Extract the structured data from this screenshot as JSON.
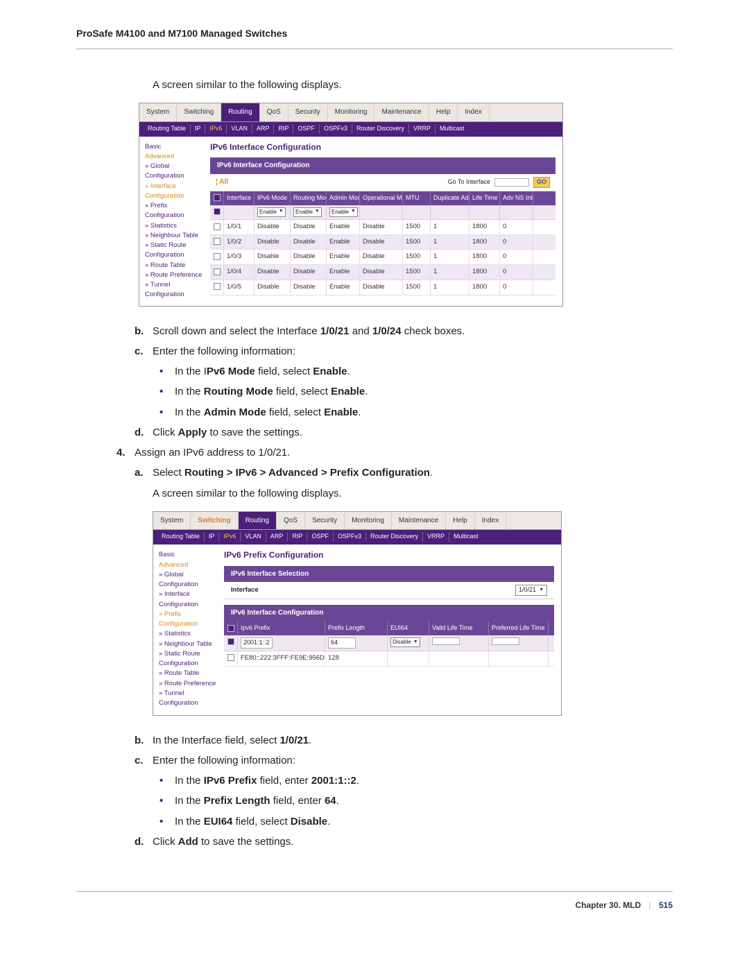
{
  "doc_header": "ProSafe M4100 and M7100 Managed Switches",
  "intro_text_1": "A screen similar to the following displays.",
  "intro_text_2": "A screen similar to the following displays.",
  "step_b_prefix": "Scroll down and select the Interface ",
  "step_b_bold1": "1/0/21",
  "step_b_mid": " and ",
  "step_b_bold2": "1/0/24",
  "step_b_suffix": " check boxes.",
  "step_c_text": "Enter the following information:",
  "bullet1_prefix": "In the I",
  "bullet1_bold": "Pv6 Mode",
  "bullet1_mid": " field, select ",
  "bullet1_val": "Enable",
  "bullet2_prefix": "In the ",
  "bullet2_bold": "Routing Mode",
  "bullet2_mid": " field, select ",
  "bullet2_val": "Enable",
  "bullet3_prefix": "In the ",
  "bullet3_bold": "Admin Mode",
  "bullet3_mid": " field, select ",
  "bullet3_val": "Enable",
  "step_d_prefix": "Click ",
  "step_d_bold": "Apply",
  "step_d_suffix": " to save the settings.",
  "step4_text": "Assign an IPv6 address to 1/0/21.",
  "step4a_prefix": "Select ",
  "step4a_bold": "Routing > IPv6 > Advanced > Prefix Configuration",
  "step4a_suffix": ".",
  "step2b_prefix": "In the Interface field, select ",
  "step2b_bold": "1/0/21",
  "step2b_suffix": ".",
  "step2c_text": "Enter the following information:",
  "b2_1_prefix": "In the ",
  "b2_1_bold": "IPv6 Prefix",
  "b2_1_mid": " field, enter ",
  "b2_1_val": "2001:1::2",
  "b2_2_prefix": "In the ",
  "b2_2_bold": "Prefix Length",
  "b2_2_mid": " field, enter ",
  "b2_2_val": "64",
  "b2_3_prefix": "In the ",
  "b2_3_bold": "EUI64",
  "b2_3_mid": " field, select ",
  "b2_3_val": "Disable",
  "step2d_prefix": "Click ",
  "step2d_bold": "Add",
  "step2d_suffix": " to save the settings.",
  "footer_chapter": "Chapter 30.  MLD",
  "footer_page": "515",
  "shot1": {
    "tabs": [
      "System",
      "Switching",
      "Routing",
      "QoS",
      "Security",
      "Monitoring",
      "Maintenance",
      "Help",
      "Index"
    ],
    "active_tab": 2,
    "subs": [
      "Routing Table",
      "IP",
      "IPv6",
      "VLAN",
      "ARP",
      "RIP",
      "OSPF",
      "OSPFv3",
      "Router Discovery",
      "VRRP",
      "Multicast"
    ],
    "active_sub": 2,
    "side": [
      "Basic",
      "Advanced",
      "» Global",
      "  Configuration",
      "» Interface",
      "  Configuration",
      "» Prefix",
      "  Configuration",
      "» Statistics",
      "» Neighbour Table",
      "» Static Route",
      "  Configuration",
      "» Route Table",
      "» Route Preference",
      "» Tunnel",
      "  Configuration"
    ],
    "side_hl": [
      1,
      4,
      5
    ],
    "title": "IPv6 Interface Configuration",
    "band": "IPv6 Interface Configuration",
    "all_label": "¦ All",
    "goto_label": "Go To Interface",
    "go_btn": "GO",
    "headers": [
      "",
      "Interface",
      "IPv6 Mode",
      "Routing Mode",
      "Admin Mode",
      "Operational Mode",
      "MTU",
      "Duplicate Address Detection Transmits",
      "Life Time Interval",
      "Adv NS Interval"
    ],
    "filter_selects": {
      "2": "Enable",
      "3": "Enable",
      "4": "Enable"
    },
    "rows": [
      {
        "iface": "1/0/1",
        "v": [
          "Disable",
          "Disable",
          "Enable",
          "Disable",
          "1500",
          "1",
          "1800",
          "0"
        ],
        "alt": false
      },
      {
        "iface": "1/0/2",
        "v": [
          "Disable",
          "Disable",
          "Enable",
          "Disable",
          "1500",
          "1",
          "1800",
          "0"
        ],
        "alt": true
      },
      {
        "iface": "1/0/3",
        "v": [
          "Disable",
          "Disable",
          "Enable",
          "Disable",
          "1500",
          "1",
          "1800",
          "0"
        ],
        "alt": false
      },
      {
        "iface": "1/0/4",
        "v": [
          "Disable",
          "Disable",
          "Enable",
          "Disable",
          "1500",
          "1",
          "1800",
          "0"
        ],
        "alt": true
      },
      {
        "iface": "1/0/5",
        "v": [
          "Disable",
          "Disable",
          "Enable",
          "Disable",
          "1500",
          "1",
          "1800",
          "0"
        ],
        "alt": false
      }
    ]
  },
  "shot2": {
    "tabs": [
      "System",
      "Switching",
      "Routing",
      "QoS",
      "Security",
      "Monitoring",
      "Maintenance",
      "Help",
      "Index"
    ],
    "orange_tab": 1,
    "active_tab": 2,
    "subs": [
      "Routing Table",
      "IP",
      "IPv6",
      "VLAN",
      "ARP",
      "RIP",
      "OSPF",
      "OSPFv3",
      "Router Discovery",
      "VRRP",
      "Multicast"
    ],
    "active_sub": 2,
    "side": [
      "Basic",
      "Advanced",
      "» Global",
      "  Configuration",
      "» Interface",
      "  Configuration",
      "» Prefix",
      "  Configuration",
      "» Statistics",
      "» Neighbour Table",
      "» Static Route",
      "  Configuration",
      "» Route Table",
      "» Route Preference",
      "» Tunnel",
      "  Configuration"
    ],
    "side_hl": [
      1,
      6,
      7
    ],
    "title": "IPv6 Prefix Configuration",
    "band1": "IPv6 Interface Selection",
    "iface_label": "Interface",
    "iface_select": "1/0/21",
    "band2": "IPv6 Interface Configuration",
    "headers": [
      "",
      "Ipv6 Prefix",
      "Prefix Length",
      "EUI64",
      "Valid Life Time",
      "Preferred Life Time"
    ],
    "filter_sel_col": 3,
    "filter_sel_val": "Disable",
    "filter_vals": {
      "1": "2001:1::2",
      "2": "64"
    },
    "rows": [
      {
        "v": [
          "FE80::222:3FFF:FE9E:956D",
          "128",
          "",
          "",
          ""
        ],
        "alt": false
      }
    ]
  }
}
